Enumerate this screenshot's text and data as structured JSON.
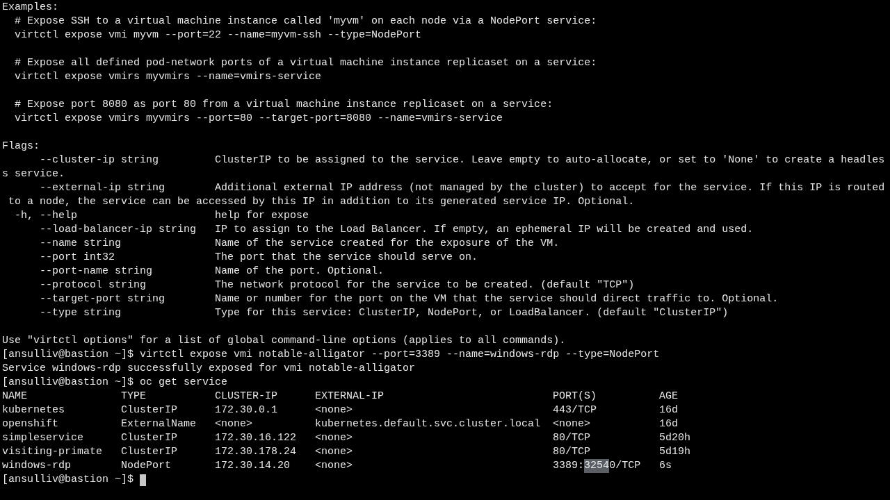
{
  "blocks": [
    [
      "Examples:",
      "  # Expose SSH to a virtual machine instance called 'myvm' on each node via a NodePort service:",
      "  virtctl expose vmi myvm --port=22 --name=myvm-ssh --type=NodePort"
    ],
    [
      "  # Expose all defined pod-network ports of a virtual machine instance replicaset on a service:",
      "  virtctl expose vmirs myvmirs --name=vmirs-service"
    ],
    [
      "  # Expose port 8080 as port 80 from a virtual machine instance replicaset on a service:",
      "  virtctl expose vmirs myvmirs --port=80 --target-port=8080 --name=vmirs-service"
    ],
    [
      "Flags:",
      "      --cluster-ip string         ClusterIP to be assigned to the service. Leave empty to auto-allocate, or set to 'None' to create a headles",
      "s service.",
      "      --external-ip string        Additional external IP address (not managed by the cluster) to accept for the service. If this IP is routed",
      " to a node, the service can be accessed by this IP in addition to its generated service IP. Optional.",
      "  -h, --help                      help for expose",
      "      --load-balancer-ip string   IP to assign to the Load Balancer. If empty, an ephemeral IP will be created and used.",
      "      --name string               Name of the service created for the exposure of the VM.",
      "      --port int32                The port that the service should serve on.",
      "      --port-name string          Name of the port. Optional.",
      "      --protocol string           The network protocol for the service to be created. (default \"TCP\")",
      "      --target-port string        Name or number for the port on the VM that the service should direct traffic to. Optional.",
      "      --type string               Type for this service: ClusterIP, NodePort, or LoadBalancer. (default \"ClusterIP\")"
    ],
    [
      "Use \"virtctl options\" for a list of global command-line options (applies to all commands).",
      "[ansulliv@bastion ~]$ virtctl expose vmi notable-alligator --port=3389 --name=windows-rdp --type=NodePort",
      "Service windows-rdp successfully exposed for vmi notable-alligator",
      "[ansulliv@bastion ~]$ oc get service"
    ]
  ],
  "table": {
    "columns": [
      "NAME",
      "TYPE",
      "CLUSTER-IP",
      "EXTERNAL-IP",
      "PORT(S)",
      "AGE"
    ],
    "rows": [
      [
        "kubernetes",
        "ClusterIP",
        "172.30.0.1",
        "<none>",
        "443/TCP",
        "16d"
      ],
      [
        "openshift",
        "ExternalName",
        "<none>",
        "kubernetes.default.svc.cluster.local",
        "<none>",
        "16d"
      ],
      [
        "simpleservice",
        "ClusterIP",
        "172.30.16.122",
        "<none>",
        "80/TCP",
        "5d20h"
      ],
      [
        "visiting-primate",
        "ClusterIP",
        "172.30.178.24",
        "<none>",
        "80/TCP",
        "5d19h"
      ],
      [
        "windows-rdp",
        "NodePort",
        "172.30.14.20",
        "<none>",
        {
          "segments": [
            {
              "text": "3389:",
              "selected": false
            },
            {
              "text": "3254",
              "selected": true
            },
            {
              "text": "0/TCP",
              "selected": false
            }
          ]
        },
        "6s"
      ]
    ]
  },
  "final_prompt": {
    "text": "[ansulliv@bastion ~]$",
    "cursor": true
  }
}
